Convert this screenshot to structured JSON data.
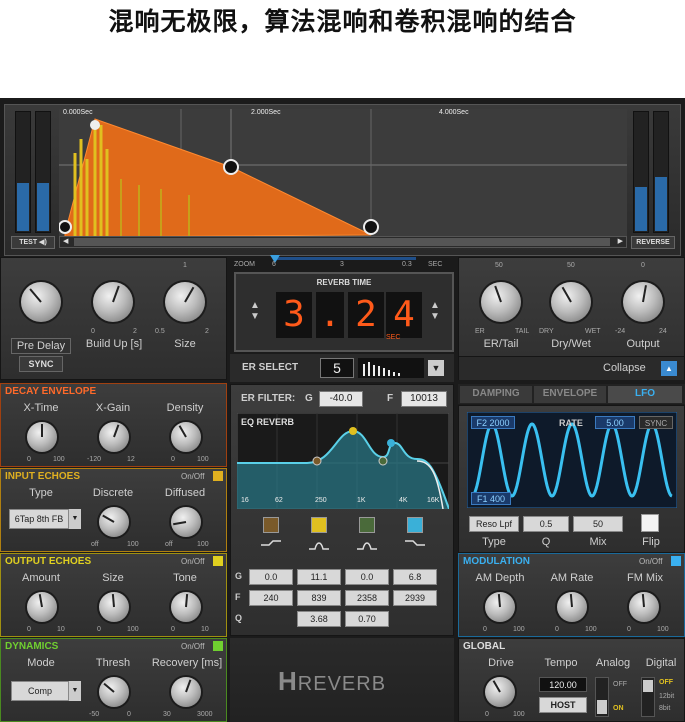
{
  "heading": "混响无极限，算法混响和卷积混响的结合",
  "display": {
    "time_markers": [
      "0.000Sec",
      "2.000Sec",
      "4.000Sec"
    ],
    "test_label": "TEST",
    "reverse_label": "REVERSE"
  },
  "zoom": {
    "label": "ZOOM",
    "ticks": [
      "6",
      "3",
      "0.3"
    ],
    "unit": "SEC"
  },
  "left_knobs": {
    "pre_delay": "Pre Delay",
    "sync": "SYNC",
    "build_up": "Build Up [s]",
    "build_min": "0",
    "build_max": "2",
    "size": "Size",
    "size_min": "0.5",
    "size_max": "2",
    "size_top": "1"
  },
  "reverb_time": {
    "title": "REVERB TIME",
    "digits": [
      "3",
      ".",
      "2",
      "4"
    ],
    "unit": "SEC"
  },
  "er_select": {
    "label": "ER SELECT",
    "value": "5"
  },
  "right_knobs": {
    "er_tail": "ER/Tail",
    "er": "ER",
    "tail": "TAIL",
    "dry_wet": "Dry/Wet",
    "dry": "DRY",
    "wet": "WET",
    "output": "Output",
    "out_min": "-24",
    "out_max": "24",
    "top50a": "50",
    "top50b": "50",
    "top0": "0"
  },
  "collapse": "Collapse",
  "decay": {
    "title": "DECAY ENVELOPE",
    "labels": [
      "X-Time",
      "X-Gain",
      "Density"
    ],
    "mins": [
      "0",
      "-120",
      "0"
    ],
    "maxs": [
      "100",
      "12",
      "100"
    ]
  },
  "input_echoes": {
    "title": "INPUT ECHOES",
    "onoff": "On/Off",
    "labels": [
      "Type",
      "Discrete",
      "Diffused"
    ],
    "type_value": "6Tap 8th FB",
    "mins": [
      "off",
      "off"
    ],
    "maxs": [
      "100",
      "100"
    ]
  },
  "output_echoes": {
    "title": "OUTPUT ECHOES",
    "onoff": "On/Off",
    "labels": [
      "Amount",
      "Size",
      "Tone"
    ],
    "mins": [
      "0",
      "0",
      "0"
    ],
    "maxs": [
      "10",
      "100",
      "10"
    ]
  },
  "dynamics": {
    "title": "DYNAMICS",
    "onoff": "On/Off",
    "labels": [
      "Mode",
      "Thresh",
      "Recovery [ms]"
    ],
    "mode_value": "Comp",
    "mins": [
      "-50",
      "30"
    ],
    "maxs": [
      "0",
      "3000"
    ]
  },
  "er_filter": {
    "label": "ER FILTER:",
    "g": "G",
    "g_value": "-40.0",
    "f": "F",
    "f_value": "10013"
  },
  "eq": {
    "title": "EQ REVERB",
    "freqs": [
      "16",
      "62",
      "250",
      "1K",
      "4K",
      "16K"
    ],
    "row_labels": [
      "G",
      "F",
      "Q"
    ],
    "g": [
      "0.0",
      "11.1",
      "0.0",
      "6.8"
    ],
    "f": [
      "240",
      "839",
      "2358",
      "2939"
    ],
    "q": [
      "3.68",
      "0.70"
    ],
    "band_colors": [
      "#7a5a2a",
      "#e0c020",
      "#4a6a3a",
      "#3ab0d8"
    ]
  },
  "logo": {
    "h": "H",
    "r": "R",
    "everb": "EVERB"
  },
  "tabs": [
    "DAMPING",
    "ENVELOPE",
    "LFO"
  ],
  "lfo": {
    "f2": "F2 2000",
    "f1": "F1 400",
    "rate": "RATE",
    "rate_value": "5.00",
    "sync": "SYNC",
    "type_value": "Reso Lpf",
    "q_value": "0.5",
    "mix_value": "50",
    "labels": [
      "Type",
      "Q",
      "Mix",
      "Flip"
    ]
  },
  "modulation": {
    "title": "MODULATION",
    "onoff": "On/Off",
    "labels": [
      "AM Depth",
      "AM Rate",
      "FM Mix"
    ],
    "mins": [
      "0",
      "0",
      "0"
    ],
    "maxs": [
      "100",
      "100",
      "100"
    ]
  },
  "global": {
    "title": "GLOBAL",
    "labels": [
      "Drive",
      "Tempo",
      "Analog",
      "Digital"
    ],
    "tempo_value": "120.00",
    "host": "HOST",
    "off": "OFF",
    "on": "ON",
    "digital": [
      "OFF",
      "12bit",
      "8bit"
    ],
    "drive_min": "0",
    "drive_max": "100"
  }
}
